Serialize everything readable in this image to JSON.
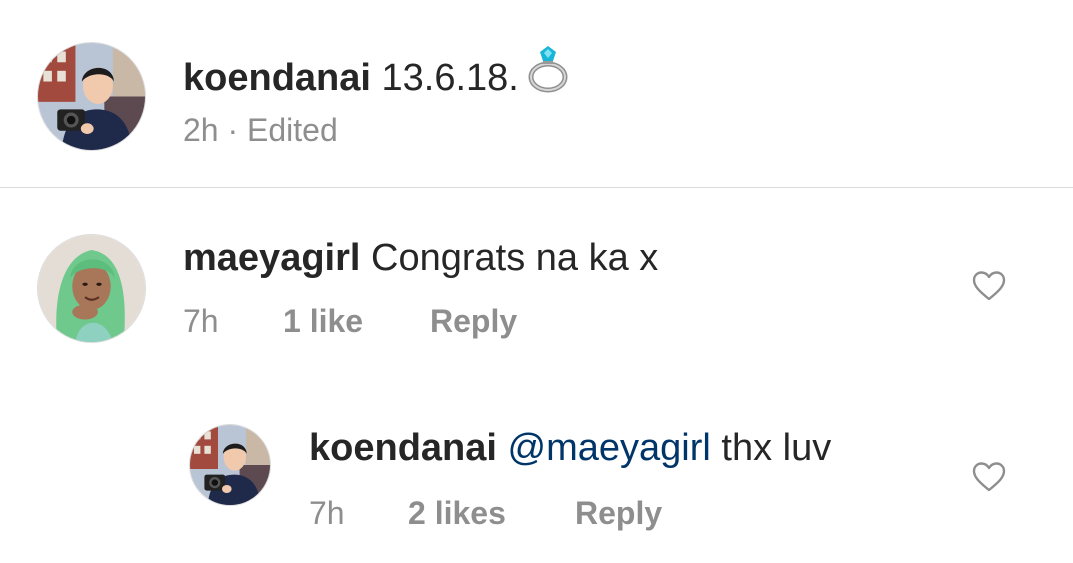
{
  "caption": {
    "username": "koendanai",
    "text": "13.6.18.",
    "emoji_icon": "ring-icon",
    "time": "2h",
    "separator": "·",
    "edited": "Edited"
  },
  "comments": [
    {
      "username": "maeyagirl",
      "text": "Congrats na ka x",
      "time": "7h",
      "likes": "1 like",
      "reply_label": "Reply",
      "like_icon": "heart-outline-icon"
    }
  ],
  "replies": [
    {
      "username": "koendanai",
      "mention": "@maeyagirl",
      "text": "thx luv",
      "time": "7h",
      "likes": "2 likes",
      "reply_label": "Reply",
      "like_icon": "heart-outline-icon"
    }
  ],
  "colors": {
    "text": "#262626",
    "secondary": "#8e8e8e",
    "mention": "#003569",
    "divider": "#dbdbdb"
  }
}
